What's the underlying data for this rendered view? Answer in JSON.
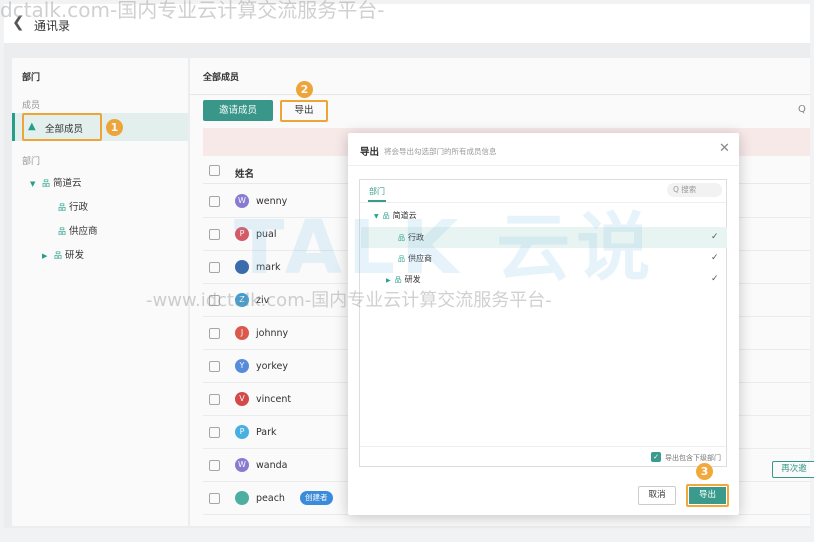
{
  "header": {
    "back_icon": "chevron-left-icon",
    "title": "通讯录"
  },
  "left": {
    "dept_header": "部门",
    "members_label": "成员",
    "all_members": "全部成员",
    "callout_1": "1",
    "dept_label": "部门",
    "tree": [
      {
        "label": "简道云",
        "expanded": true
      },
      {
        "label": "行政"
      },
      {
        "label": "供应商"
      },
      {
        "label": "研发",
        "expanded": false
      }
    ]
  },
  "main": {
    "header": "全部成员",
    "invite_label": "邀请成员",
    "export_label": "导出",
    "callout_2": "2",
    "search_glyph": "Q",
    "col_name": "姓名",
    "members": [
      {
        "initial": "W",
        "name": "wenny",
        "color": "#8a7fd6"
      },
      {
        "initial": "P",
        "name": "pual",
        "color": "#d95c6b"
      },
      {
        "initial": "",
        "name": "mark",
        "color": "#3c6fb0"
      },
      {
        "initial": "Z",
        "name": "ziv",
        "color": "#3fa2d8"
      },
      {
        "initial": "J",
        "name": "johnny",
        "color": "#e05a4f"
      },
      {
        "initial": "Y",
        "name": "yorkey",
        "color": "#5a8fe0"
      },
      {
        "initial": "V",
        "name": "vincent",
        "color": "#d94b4b"
      },
      {
        "initial": "P",
        "name": "Park",
        "color": "#4ab4e6"
      },
      {
        "initial": "W",
        "name": "wanda",
        "color": "#8a7fd6"
      },
      {
        "initial": "",
        "name": "peach",
        "color": "#4fb3a6",
        "tag": "创建者"
      }
    ],
    "reinvite_label": "再次邀"
  },
  "modal": {
    "title": "导出",
    "desc": "将会导出勾选部门的所有成员信息",
    "close_glyph": "✕",
    "tab_label": "部门",
    "search_placeholder": "Q 搜索",
    "tree": [
      {
        "label": "简道云",
        "checked": false
      },
      {
        "label": "行政",
        "checked": true
      },
      {
        "label": "供应商",
        "checked": true
      },
      {
        "label": "研发",
        "checked": true
      }
    ],
    "check_glyph": "✓",
    "include_label": "导出包含下级部门",
    "cancel_label": "取消",
    "confirm_label": "导出",
    "callout_3": "3"
  },
  "watermark": {
    "top": "dctalk.com-国内专业云计算交流服务平台-",
    "middle": "-www.idctalk.com-国内专业云计算交流服务平台-",
    "logo_text": "TALK 云说"
  }
}
